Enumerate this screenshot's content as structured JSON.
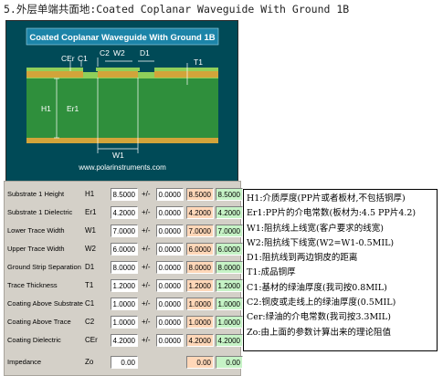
{
  "heading": "5.外层单端共面地:Coated Coplanar Waveguide With Ground 1B",
  "diagram": {
    "title": "Coated Coplanar Waveguide With Ground 1B",
    "url": "www.polarinstruments.com",
    "labels": {
      "cer": "CEr",
      "c1": "C1",
      "c2": "C2",
      "d1": "D1",
      "t1": "T1",
      "h1": "H1",
      "er1": "Er1",
      "w2": "W2",
      "w1": "W1"
    }
  },
  "params": [
    {
      "label": "Substrate 1 Height",
      "symbol": "H1",
      "value": "8.5000",
      "tol": "0.0000",
      "min": "8.5000",
      "max": "8.5000"
    },
    {
      "label": "Substrate 1 Dielectric",
      "symbol": "Er1",
      "value": "4.2000",
      "tol": "0.0000",
      "min": "4.2000",
      "max": "4.2000"
    },
    {
      "label": "Lower Trace Width",
      "symbol": "W1",
      "value": "7.0000",
      "tol": "0.0000",
      "min": "7.0000",
      "max": "7.0000"
    },
    {
      "label": "Upper Trace Width",
      "symbol": "W2",
      "value": "6.0000",
      "tol": "0.0000",
      "min": "6.0000",
      "max": "6.0000"
    },
    {
      "label": "Ground Strip Separation",
      "symbol": "D1",
      "value": "8.0000",
      "tol": "0.0000",
      "min": "8.0000",
      "max": "8.0000"
    },
    {
      "label": "Trace Thickness",
      "symbol": "T1",
      "value": "1.2000",
      "tol": "0.0000",
      "min": "1.2000",
      "max": "1.2000"
    },
    {
      "label": "Coating Above Substrate",
      "symbol": "C1",
      "value": "1.0000",
      "tol": "0.0000",
      "min": "1.0000",
      "max": "1.0000"
    },
    {
      "label": "Coating Above Trace",
      "symbol": "C2",
      "value": "1.0000",
      "tol": "0.0000",
      "min": "1.0000",
      "max": "1.0000"
    },
    {
      "label": "Coating Dielectric",
      "symbol": "CEr",
      "value": "4.2000",
      "tol": "0.0000",
      "min": "4.2000",
      "max": "4.2000"
    }
  ],
  "pm": "+/-",
  "impedance": {
    "label": "Impedance",
    "symbol": "Zo",
    "value": "0.00",
    "min": "0.00",
    "max": "0.00"
  },
  "notes": [
    "H1:介质厚度(PP片或者板材,不包括铜厚)",
    "Er1:PP片的介电常数(板材为:4.5 PP片4.2)",
    "W1:阻抗线上线宽(客户要求的线宽)",
    "W2:阻抗线下线宽(W2=W1-0.5MIL)",
    "D1:阻抗线到两边铜皮的距离",
    "T1:成品铜厚",
    "C1:基材的绿油厚度(我司按0.8MIL)",
    "C2:铜皮或走线上的绿油厚度(0.5MIL)",
    "Cer:绿油的介电常数(我司按3.3MIL)",
    "Zo:由上面的参数计算出来的理论阻值"
  ],
  "colors": {
    "frame": "#004a57",
    "substrate": "#2f8f3c",
    "copper": "#d2a43a",
    "coating": "#8fcf5a",
    "min_field": "#ffd7b8",
    "max_field": "#c6f3c6"
  }
}
